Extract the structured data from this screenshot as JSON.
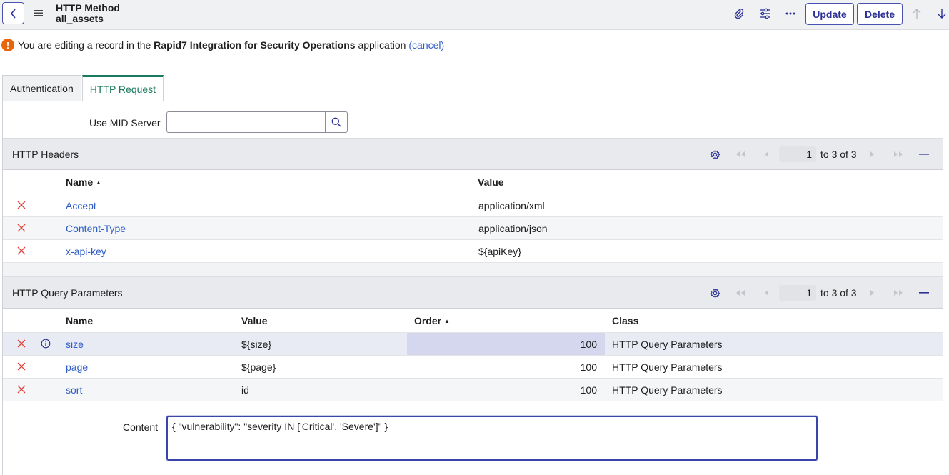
{
  "header": {
    "title": "HTTP Method",
    "subtitle": "all_assets",
    "update_label": "Update",
    "delete_label": "Delete"
  },
  "notice": {
    "prefix": "You are editing a record in the",
    "app_name": "Rapid7 Integration for Security Operations",
    "suffix": "application",
    "cancel_label": "(cancel)"
  },
  "tabs": [
    {
      "label": "Authentication",
      "active": false
    },
    {
      "label": "HTTP Request",
      "active": true
    }
  ],
  "mid_server": {
    "label": "Use MID Server",
    "value": ""
  },
  "headers_list": {
    "title": "HTTP Headers",
    "page_value": "1",
    "page_text": "to 3 of 3",
    "columns": [
      "Name",
      "Value"
    ],
    "rows": [
      {
        "name": "Accept",
        "value": "application/xml"
      },
      {
        "name": "Content-Type",
        "value": "application/json"
      },
      {
        "name": "x-api-key",
        "value": "${apiKey}"
      }
    ]
  },
  "query_list": {
    "title": "HTTP Query Parameters",
    "page_value": "1",
    "page_text": "to 3 of 3",
    "columns": [
      "Name",
      "Value",
      "Order",
      "Class"
    ],
    "rows": [
      {
        "name": "size",
        "value": "${size}",
        "order": "100",
        "class": "HTTP Query Parameters"
      },
      {
        "name": "page",
        "value": "${page}",
        "order": "100",
        "class": "HTTP Query Parameters"
      },
      {
        "name": "sort",
        "value": "id",
        "order": "100",
        "class": "HTTP Query Parameters"
      }
    ]
  },
  "content": {
    "label": "Content",
    "value": "{ \"vulnerability\": \"severity IN ['Critical', 'Severe']\" }"
  },
  "colors": {
    "accent": "#2b3196",
    "link": "#2e5cc7",
    "delete": "#e0433a",
    "active_tab": "#1a7a5e",
    "warning": "#e8650c"
  }
}
